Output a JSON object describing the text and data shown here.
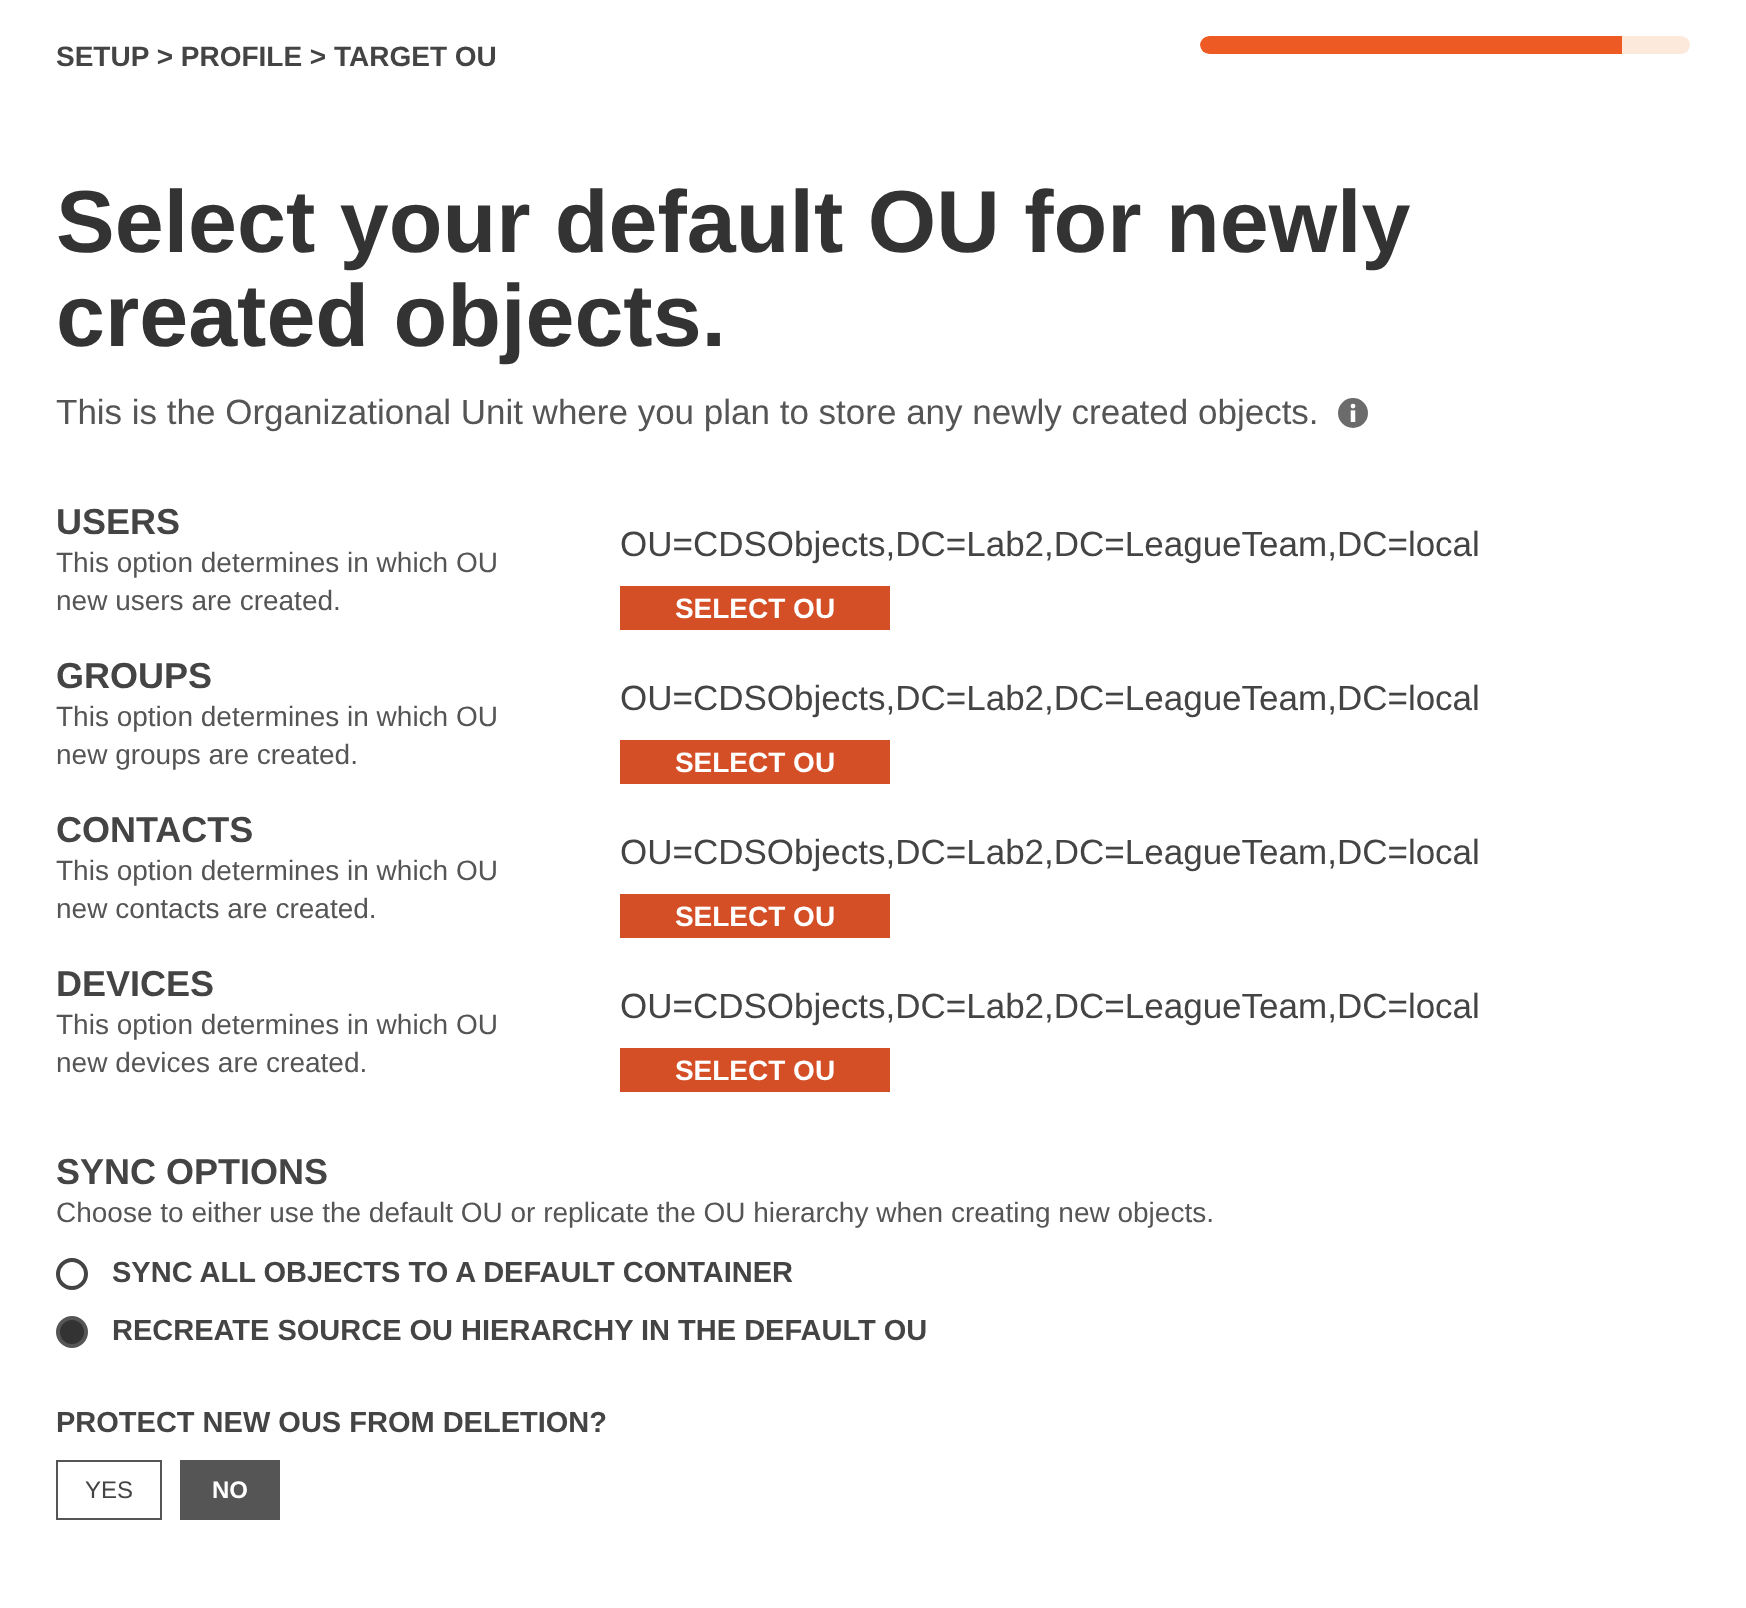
{
  "breadcrumb": "SETUP > PROFILE > TARGET OU",
  "progress": {
    "level": 0.86
  },
  "title": "Select your default OU for newly created objects.",
  "subtitle": "This is the Organizational Unit where you plan to store any newly created objects.",
  "sections": [
    {
      "heading": "USERS",
      "description": "This option determines in which OU new users are created.",
      "value": "OU=CDSObjects,DC=Lab2,DC=LeagueTeam,DC=local",
      "button": "SELECT OU"
    },
    {
      "heading": "GROUPS",
      "description": "This option determines in which OU new groups are created.",
      "value": "OU=CDSObjects,DC=Lab2,DC=LeagueTeam,DC=local",
      "button": "SELECT OU"
    },
    {
      "heading": "CONTACTS",
      "description": "This option determines in which OU new contacts are created.",
      "value": "OU=CDSObjects,DC=Lab2,DC=LeagueTeam,DC=local",
      "button": "SELECT OU"
    },
    {
      "heading": "DEVICES",
      "description": "This option determines in which OU new devices are created.",
      "value": "OU=CDSObjects,DC=Lab2,DC=LeagueTeam,DC=local",
      "button": "SELECT OU"
    }
  ],
  "sync_options": {
    "heading": "SYNC OPTIONS",
    "description": "Choose to either use the default OU or replicate the OU hierarchy when creating new objects.",
    "options": [
      {
        "label": "SYNC ALL OBJECTS TO A DEFAULT CONTAINER",
        "selected": false
      },
      {
        "label": "RECREATE SOURCE OU HIERARCHY IN THE DEFAULT OU",
        "selected": true
      }
    ]
  },
  "protect": {
    "heading": "PROTECT NEW OUS FROM DELETION?",
    "choices": [
      {
        "label": "YES",
        "selected": false
      },
      {
        "label": "NO",
        "selected": true
      }
    ]
  }
}
